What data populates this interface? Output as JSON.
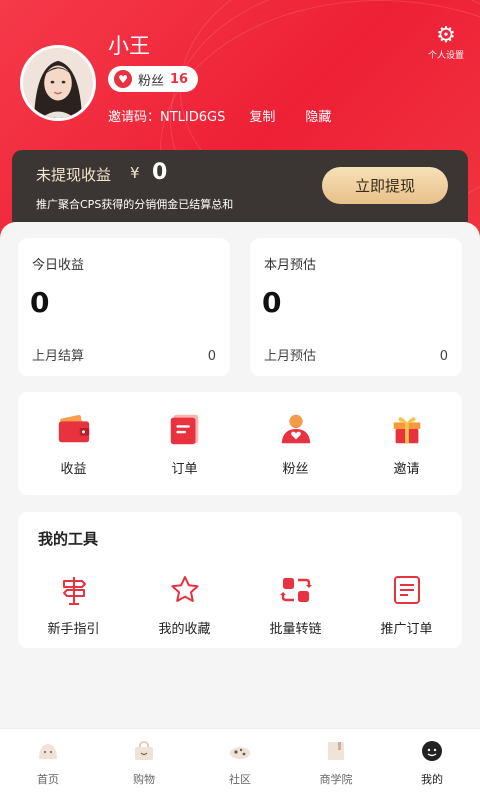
{
  "profile": {
    "name": "小王",
    "fans_label": "粉丝",
    "fans_count": "16",
    "invite_label": "邀请码：NTLID6GS",
    "copy_label": "复制",
    "hide_label": "隐藏",
    "settings_label": "个人设置"
  },
  "earnings": {
    "label": "未提现收益",
    "currency": "¥",
    "amount": "0",
    "description": "推广聚合CPS获得的分销佣金已结算总和",
    "withdraw_label": "立即提现"
  },
  "stats": {
    "today": {
      "title": "今日收益",
      "value": "0",
      "foot_label": "上月结算",
      "foot_value": "0"
    },
    "month": {
      "title": "本月预估",
      "value": "0",
      "foot_label": "上月预估",
      "foot_value": "0"
    }
  },
  "quick_actions": [
    {
      "label": "收益",
      "icon": "wallet-icon"
    },
    {
      "label": "订单",
      "icon": "order-icon"
    },
    {
      "label": "粉丝",
      "icon": "fans-icon"
    },
    {
      "label": "邀请",
      "icon": "gift-icon"
    }
  ],
  "tools": {
    "title": "我的工具",
    "items": [
      {
        "label": "新手指引",
        "icon": "signpost-icon"
      },
      {
        "label": "我的收藏",
        "icon": "star-icon"
      },
      {
        "label": "批量转链",
        "icon": "convert-icon"
      },
      {
        "label": "推广订单",
        "icon": "document-icon"
      }
    ]
  },
  "tabbar": [
    {
      "label": "首页",
      "icon": "home-icon",
      "active": false
    },
    {
      "label": "购物",
      "icon": "bag-icon",
      "active": false
    },
    {
      "label": "社区",
      "icon": "community-icon",
      "active": false
    },
    {
      "label": "商学院",
      "icon": "book-icon",
      "active": false
    },
    {
      "label": "我的",
      "icon": "profile-icon",
      "active": true
    }
  ],
  "colors": {
    "brand": "#ee2036",
    "card_dark": "#3b3633",
    "gold": "#e7c08a"
  }
}
